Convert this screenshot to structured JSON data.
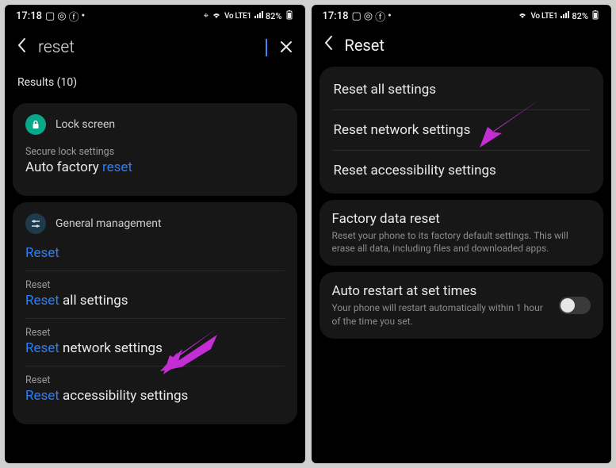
{
  "status": {
    "time": "17:18",
    "left_icons": [
      "image-icon",
      "instagram-icon",
      "facebook-icon",
      "dot-icon"
    ],
    "right_text": "82%",
    "net_label": "Vo LTE1",
    "show_location": true
  },
  "left_screen": {
    "search_value": "reset",
    "results_label": "Results (10)",
    "groups": [
      {
        "category": "Lock screen",
        "icon_color": "teal",
        "icon_glyph": "lock",
        "items": [
          {
            "sub": "Secure lock settings",
            "title_pre": "Auto factory ",
            "title_hl": "reset",
            "title_post": ""
          }
        ]
      },
      {
        "category": "General management",
        "icon_color": "gray",
        "icon_glyph": "sliders",
        "items": [
          {
            "sub": "",
            "title_pre": "",
            "title_hl": "Reset",
            "title_post": ""
          },
          {
            "sub": "Reset",
            "title_pre": "",
            "title_hl": "Reset",
            "title_post": " all settings"
          },
          {
            "sub": "Reset",
            "title_pre": "",
            "title_hl": "Reset",
            "title_post": " network settings"
          },
          {
            "sub": "Reset",
            "title_pre": "",
            "title_hl": "Reset",
            "title_post": " accessibility settings"
          }
        ]
      }
    ]
  },
  "right_screen": {
    "title": "Reset",
    "rows": [
      {
        "title": "Reset all settings",
        "desc": ""
      },
      {
        "title": "Reset network settings",
        "desc": ""
      },
      {
        "title": "Reset accessibility settings",
        "desc": ""
      }
    ],
    "factory": {
      "title": "Factory data reset",
      "desc": "Reset your phone to its factory default settings. This will erase all data, including files and downloaded apps."
    },
    "auto_restart": {
      "title": "Auto restart at set times",
      "desc": "Your phone will restart automatically within 1 hour of the time you set.",
      "enabled": false
    }
  },
  "annotation_color": "#c22ed3"
}
